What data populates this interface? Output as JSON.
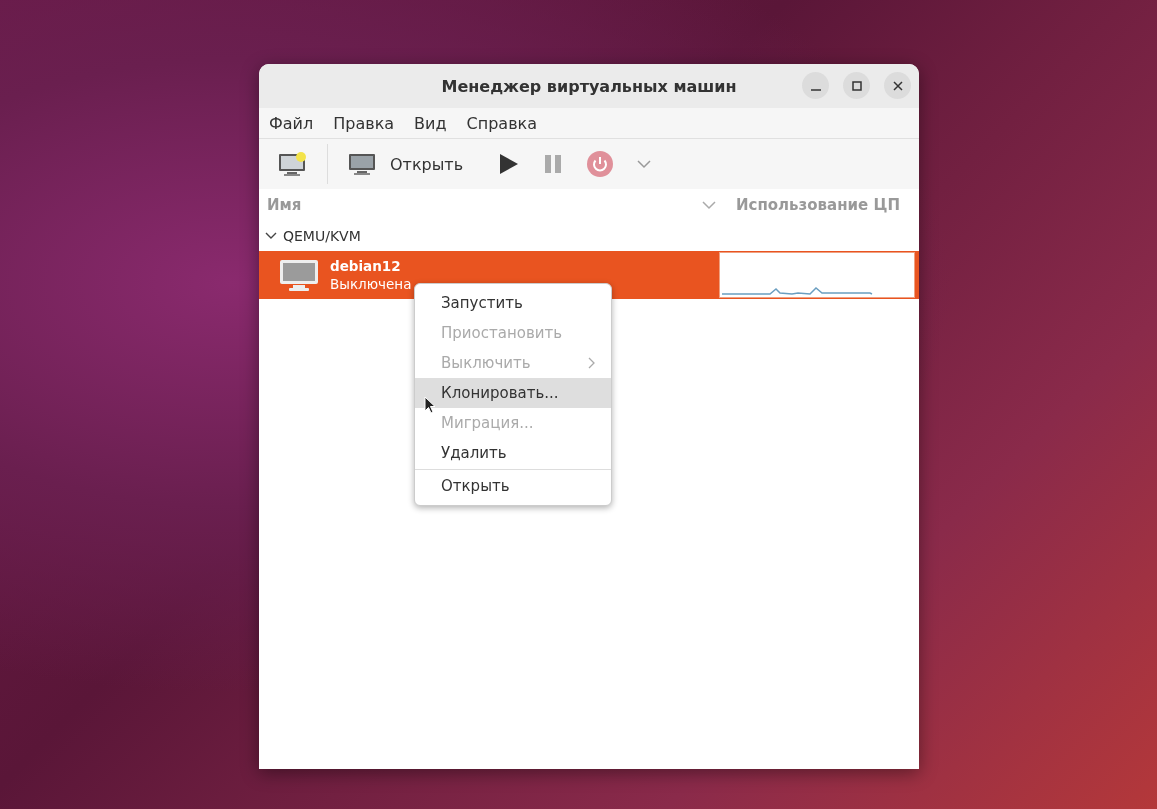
{
  "window": {
    "title": "Менеджер виртуальных машин"
  },
  "menubar": [
    "Файл",
    "Правка",
    "Вид",
    "Справка"
  ],
  "toolbar": {
    "open_label": "Открыть",
    "pause_disabled": true,
    "shutdown_disabled": true
  },
  "columns": [
    "Имя",
    "Использование ЦП"
  ],
  "groups": [
    {
      "label": "QEMU/KVM",
      "expanded": true,
      "vms": [
        {
          "name": "debian12",
          "status": "Выключена",
          "selected": true
        }
      ]
    }
  ],
  "context_menu": [
    {
      "label": "Запустить",
      "disabled": false,
      "selected": false,
      "submenu": false
    },
    {
      "label": "Приостановить",
      "disabled": true,
      "selected": false,
      "submenu": false
    },
    {
      "label": "Выключить",
      "disabled": true,
      "selected": false,
      "submenu": true
    },
    {
      "label": "Клонировать...",
      "disabled": false,
      "selected": true,
      "submenu": false
    },
    {
      "label": "Миграция...",
      "disabled": true,
      "selected": false,
      "submenu": false
    },
    {
      "label": "Удалить",
      "disabled": false,
      "selected": false,
      "submenu": false
    },
    {
      "kind": "separator"
    },
    {
      "label": "Открыть",
      "disabled": false,
      "selected": false,
      "submenu": false
    }
  ]
}
